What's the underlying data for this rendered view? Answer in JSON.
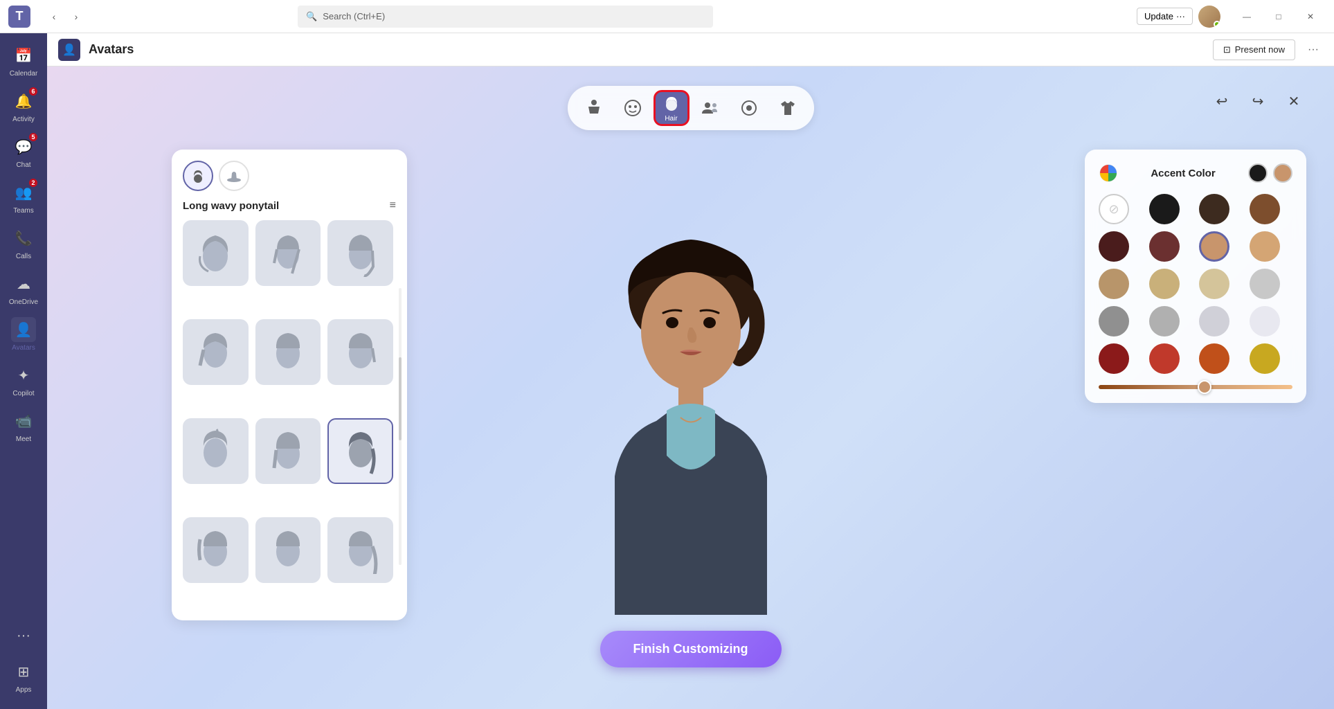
{
  "titleBar": {
    "appName": "Microsoft Teams",
    "searchPlaceholder": "Search (Ctrl+E)",
    "updateLabel": "Update",
    "windowControls": {
      "minimize": "—",
      "maximize": "□",
      "close": "✕"
    }
  },
  "sidebar": {
    "items": [
      {
        "id": "calendar",
        "label": "Calendar",
        "icon": "📅",
        "badge": null,
        "active": false
      },
      {
        "id": "activity",
        "label": "Activity",
        "icon": "🔔",
        "badge": "6",
        "active": false
      },
      {
        "id": "chat",
        "label": "Chat",
        "icon": "💬",
        "badge": "5",
        "active": false
      },
      {
        "id": "teams",
        "label": "Teams",
        "icon": "👥",
        "badge": "2",
        "active": false
      },
      {
        "id": "calls",
        "label": "Calls",
        "icon": "📞",
        "badge": null,
        "active": false
      },
      {
        "id": "onedrive",
        "label": "OneDrive",
        "icon": "☁",
        "badge": null,
        "active": false
      },
      {
        "id": "avatars",
        "label": "Avatars",
        "icon": "👤",
        "badge": null,
        "active": true
      },
      {
        "id": "copilot",
        "label": "Copilot",
        "icon": "✦",
        "badge": null,
        "active": false
      },
      {
        "id": "meet",
        "label": "Meet",
        "icon": "📹",
        "badge": null,
        "active": false
      }
    ],
    "bottom": [
      {
        "id": "more",
        "label": "···",
        "icon": "···",
        "badge": null
      },
      {
        "id": "apps",
        "label": "Apps",
        "icon": "⊞",
        "badge": null
      }
    ]
  },
  "pageHeader": {
    "icon": "👤",
    "title": "Avatars",
    "presentNow": "Present now",
    "moreOptions": "···"
  },
  "categoryToolbar": {
    "items": [
      {
        "id": "body",
        "icon": "🧍",
        "label": "",
        "active": false
      },
      {
        "id": "face",
        "icon": "😊",
        "label": "",
        "active": false
      },
      {
        "id": "hair",
        "icon": "👤",
        "label": "Hair",
        "active": true,
        "selected": true
      },
      {
        "id": "group",
        "icon": "👫",
        "label": "",
        "active": false
      },
      {
        "id": "accessories",
        "icon": "🎽",
        "label": "",
        "active": false
      },
      {
        "id": "clothing",
        "icon": "👕",
        "label": "",
        "active": false
      }
    ]
  },
  "hairPanel": {
    "tabs": [
      {
        "id": "hair-style",
        "icon": "👤",
        "active": true
      },
      {
        "id": "hat",
        "icon": "🎩",
        "active": false
      }
    ],
    "styleName": "Long wavy ponytail",
    "filterLabel": "Filter",
    "items": [
      {
        "id": 1,
        "selected": false
      },
      {
        "id": 2,
        "selected": false
      },
      {
        "id": 3,
        "selected": false
      },
      {
        "id": 4,
        "selected": false
      },
      {
        "id": 5,
        "selected": false
      },
      {
        "id": 6,
        "selected": false
      },
      {
        "id": 7,
        "selected": false
      },
      {
        "id": 8,
        "selected": false
      },
      {
        "id": 9,
        "selected": true
      },
      {
        "id": 10,
        "selected": false
      },
      {
        "id": 11,
        "selected": false
      },
      {
        "id": 12,
        "selected": false
      }
    ]
  },
  "colorPanel": {
    "title": "Accent Color",
    "selectedColors": [
      "#2d2d2d",
      "#c8956c"
    ],
    "colors": [
      {
        "id": "none",
        "value": "none",
        "label": "None"
      },
      {
        "id": "black",
        "value": "#1a1a1a",
        "label": "Black"
      },
      {
        "id": "dark-brown",
        "value": "#3d2b1f",
        "label": "Dark Brown"
      },
      {
        "id": "brown",
        "value": "#7d4e2d",
        "label": "Brown"
      },
      {
        "id": "dark-auburn",
        "value": "#4a1c1c",
        "label": "Dark Auburn"
      },
      {
        "id": "auburn",
        "value": "#6b3030",
        "label": "Auburn"
      },
      {
        "id": "caramel",
        "value": "#c8956c",
        "label": "Caramel",
        "selected": true
      },
      {
        "id": "light-caramel",
        "value": "#d4a574",
        "label": "Light Caramel"
      },
      {
        "id": "golden",
        "value": "#b8956a",
        "label": "Golden"
      },
      {
        "id": "light-golden",
        "value": "#c9b07a",
        "label": "Light Golden"
      },
      {
        "id": "light-brown",
        "value": "#d4c49a",
        "label": "Light Brown"
      },
      {
        "id": "platinum",
        "value": "#c8c8c8",
        "label": "Platinum"
      },
      {
        "id": "gray",
        "value": "#909090",
        "label": "Gray"
      },
      {
        "id": "light-gray",
        "value": "#b0b0b0",
        "label": "Light Gray"
      },
      {
        "id": "silver",
        "value": "#d0d0d8",
        "label": "Silver"
      },
      {
        "id": "dark-red",
        "value": "#8b1a1a",
        "label": "Dark Red"
      },
      {
        "id": "red",
        "value": "#c0392b",
        "label": "Red"
      },
      {
        "id": "orange-red",
        "value": "#c0501a",
        "label": "Orange Red"
      },
      {
        "id": "golden-yellow",
        "value": "#c8a820",
        "label": "Golden Yellow"
      }
    ],
    "sliderValue": 55
  },
  "finishButton": {
    "label": "Finish Customizing"
  },
  "workspaceControls": {
    "undo": "↩",
    "redo": "↪",
    "close": "✕"
  }
}
